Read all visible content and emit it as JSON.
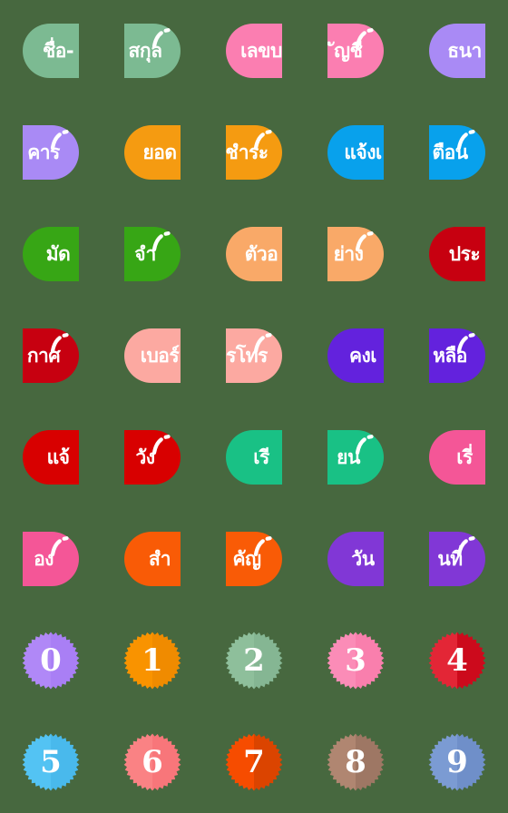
{
  "sheet": {
    "title": "Thai Label Emoji Sticker Sheet",
    "background_color": "#47683f",
    "columns": 5,
    "rows": 8,
    "text_color": "#ffffff"
  },
  "tiles": [
    {
      "text": "ชื่อ-",
      "color": "#7cba92",
      "shade": "#6fae86",
      "side": "left",
      "gloss": false,
      "name": "tile-chue"
    },
    {
      "text": "สกุล",
      "color": "#7cba92",
      "shade": "#6fae86",
      "side": "right",
      "gloss": true,
      "name": "tile-sakun"
    },
    {
      "text": "เลขบ",
      "color": "#fb7eb1",
      "shade": "#f96ea6",
      "side": "left",
      "gloss": false,
      "name": "tile-lekba"
    },
    {
      "text": "ัญชี",
      "color": "#fb7eb1",
      "shade": "#f96ea6",
      "side": "right",
      "gloss": true,
      "name": "tile-banchi"
    },
    {
      "text": "ธนา",
      "color": "#a98af5",
      "shade": "#9d7bf3",
      "side": "left",
      "gloss": false,
      "name": "tile-thana"
    },
    {
      "text": "คาร",
      "color": "#a98af5",
      "shade": "#9d7bf3",
      "side": "right",
      "gloss": true,
      "name": "tile-khan"
    },
    {
      "text": "ยอด",
      "color": "#f59b11",
      "shade": "#ef9209",
      "side": "left",
      "gloss": false,
      "name": "tile-yot"
    },
    {
      "text": "ชำระ",
      "color": "#f59b11",
      "shade": "#ef9209",
      "side": "right",
      "gloss": true,
      "name": "tile-chamra"
    },
    {
      "text": "แจ้งเ",
      "color": "#08a1ec",
      "shade": "#0596e0",
      "side": "left",
      "gloss": false,
      "name": "tile-chaengte"
    },
    {
      "text": "ตือน",
      "color": "#08a1ec",
      "shade": "#0596e0",
      "side": "right",
      "gloss": true,
      "name": "tile-tuean"
    },
    {
      "text": "มัด",
      "color": "#37a615",
      "shade": "#319a11",
      "side": "left",
      "gloss": false,
      "name": "tile-mat"
    },
    {
      "text": "จำ",
      "color": "#37a615",
      "shade": "#319a11",
      "side": "right",
      "gloss": true,
      "name": "tile-cham"
    },
    {
      "text": "ตัวอ",
      "color": "#f9a968",
      "shade": "#f79e57",
      "side": "left",
      "gloss": false,
      "name": "tile-tuao"
    },
    {
      "text": "ย่าง",
      "color": "#f9a968",
      "shade": "#f79e57",
      "side": "right",
      "gloss": true,
      "name": "tile-yang"
    },
    {
      "text": "ประ",
      "color": "#c70010",
      "shade": "#b8000e",
      "side": "left",
      "gloss": false,
      "name": "tile-pra"
    },
    {
      "text": "กาศ",
      "color": "#c70010",
      "shade": "#b8000e",
      "side": "right",
      "gloss": true,
      "name": "tile-kat"
    },
    {
      "text": "เบอร์",
      "color": "#fca9a1",
      "shade": "#fa9c93",
      "side": "left",
      "gloss": false,
      "name": "tile-boe"
    },
    {
      "text": "รโทร",
      "color": "#fca9a1",
      "shade": "#fa9c93",
      "side": "right",
      "gloss": true,
      "name": "tile-thon"
    },
    {
      "text": "คงเ",
      "color": "#6322dd",
      "shade": "#5a1ed0",
      "side": "left",
      "gloss": false,
      "name": "tile-khongte"
    },
    {
      "text": "หลือ",
      "color": "#6322dd",
      "shade": "#5a1ed0",
      "side": "right",
      "gloss": true,
      "name": "tile-luea"
    },
    {
      "text": "แจ้",
      "color": "#d80000",
      "shade": "#c90000",
      "side": "left",
      "gloss": false,
      "name": "tile-chae"
    },
    {
      "text": "วัง",
      "color": "#d80000",
      "shade": "#c90000",
      "side": "right",
      "gloss": true,
      "name": "tile-wang"
    },
    {
      "text": "เรี",
      "color": "#19c185",
      "shade": "#14b67b",
      "side": "left",
      "gloss": false,
      "name": "tile-ri"
    },
    {
      "text": "ยน",
      "color": "#19c185",
      "shade": "#14b67b",
      "side": "right",
      "gloss": true,
      "name": "tile-yon"
    },
    {
      "text": "เรี่",
      "color": "#f45697",
      "shade": "#f2468c",
      "side": "left",
      "gloss": false,
      "name": "tile-riang"
    },
    {
      "text": "อง",
      "color": "#f45697",
      "shade": "#f2468c",
      "side": "right",
      "gloss": true,
      "name": "tile-ong"
    },
    {
      "text": "สำ",
      "color": "#f95b06",
      "shade": "#f05404",
      "side": "left",
      "gloss": false,
      "name": "tile-sam"
    },
    {
      "text": "คัญ",
      "color": "#f95b06",
      "shade": "#f05404",
      "side": "right",
      "gloss": true,
      "name": "tile-khan2"
    },
    {
      "text": "วัน",
      "color": "#8137d6",
      "shade": "#7730cb",
      "side": "left",
      "gloss": false,
      "name": "tile-wan"
    },
    {
      "text": "นที่",
      "color": "#8137d6",
      "shade": "#7730cb",
      "side": "right",
      "gloss": true,
      "name": "tile-thi"
    }
  ],
  "numbers": [
    {
      "text": "0",
      "color": "#b088f7",
      "shade": "#a97ff5",
      "name": "badge-0"
    },
    {
      "text": "1",
      "color": "#f99300",
      "shade": "#f08b00",
      "name": "badge-1"
    },
    {
      "text": "2",
      "color": "#8ebf9b",
      "shade": "#85b693",
      "name": "badge-2"
    },
    {
      "text": "3",
      "color": "#fb8cb7",
      "shade": "#f97fad",
      "name": "badge-3"
    },
    {
      "text": "4",
      "color": "#e32636",
      "shade": "#cc0a1c",
      "name": "badge-4"
    },
    {
      "text": "5",
      "color": "#53c3f3",
      "shade": "#49b9ec",
      "name": "badge-5"
    },
    {
      "text": "6",
      "color": "#fa8284",
      "shade": "#f8767a",
      "name": "badge-6"
    },
    {
      "text": "7",
      "color": "#f64c00",
      "shade": "#db4400",
      "name": "badge-7"
    },
    {
      "text": "8",
      "color": "#b08671",
      "shade": "#9e7764",
      "name": "badge-8"
    },
    {
      "text": "9",
      "color": "#7b9bd3",
      "shade": "#6f8fc9",
      "name": "badge-9"
    }
  ]
}
